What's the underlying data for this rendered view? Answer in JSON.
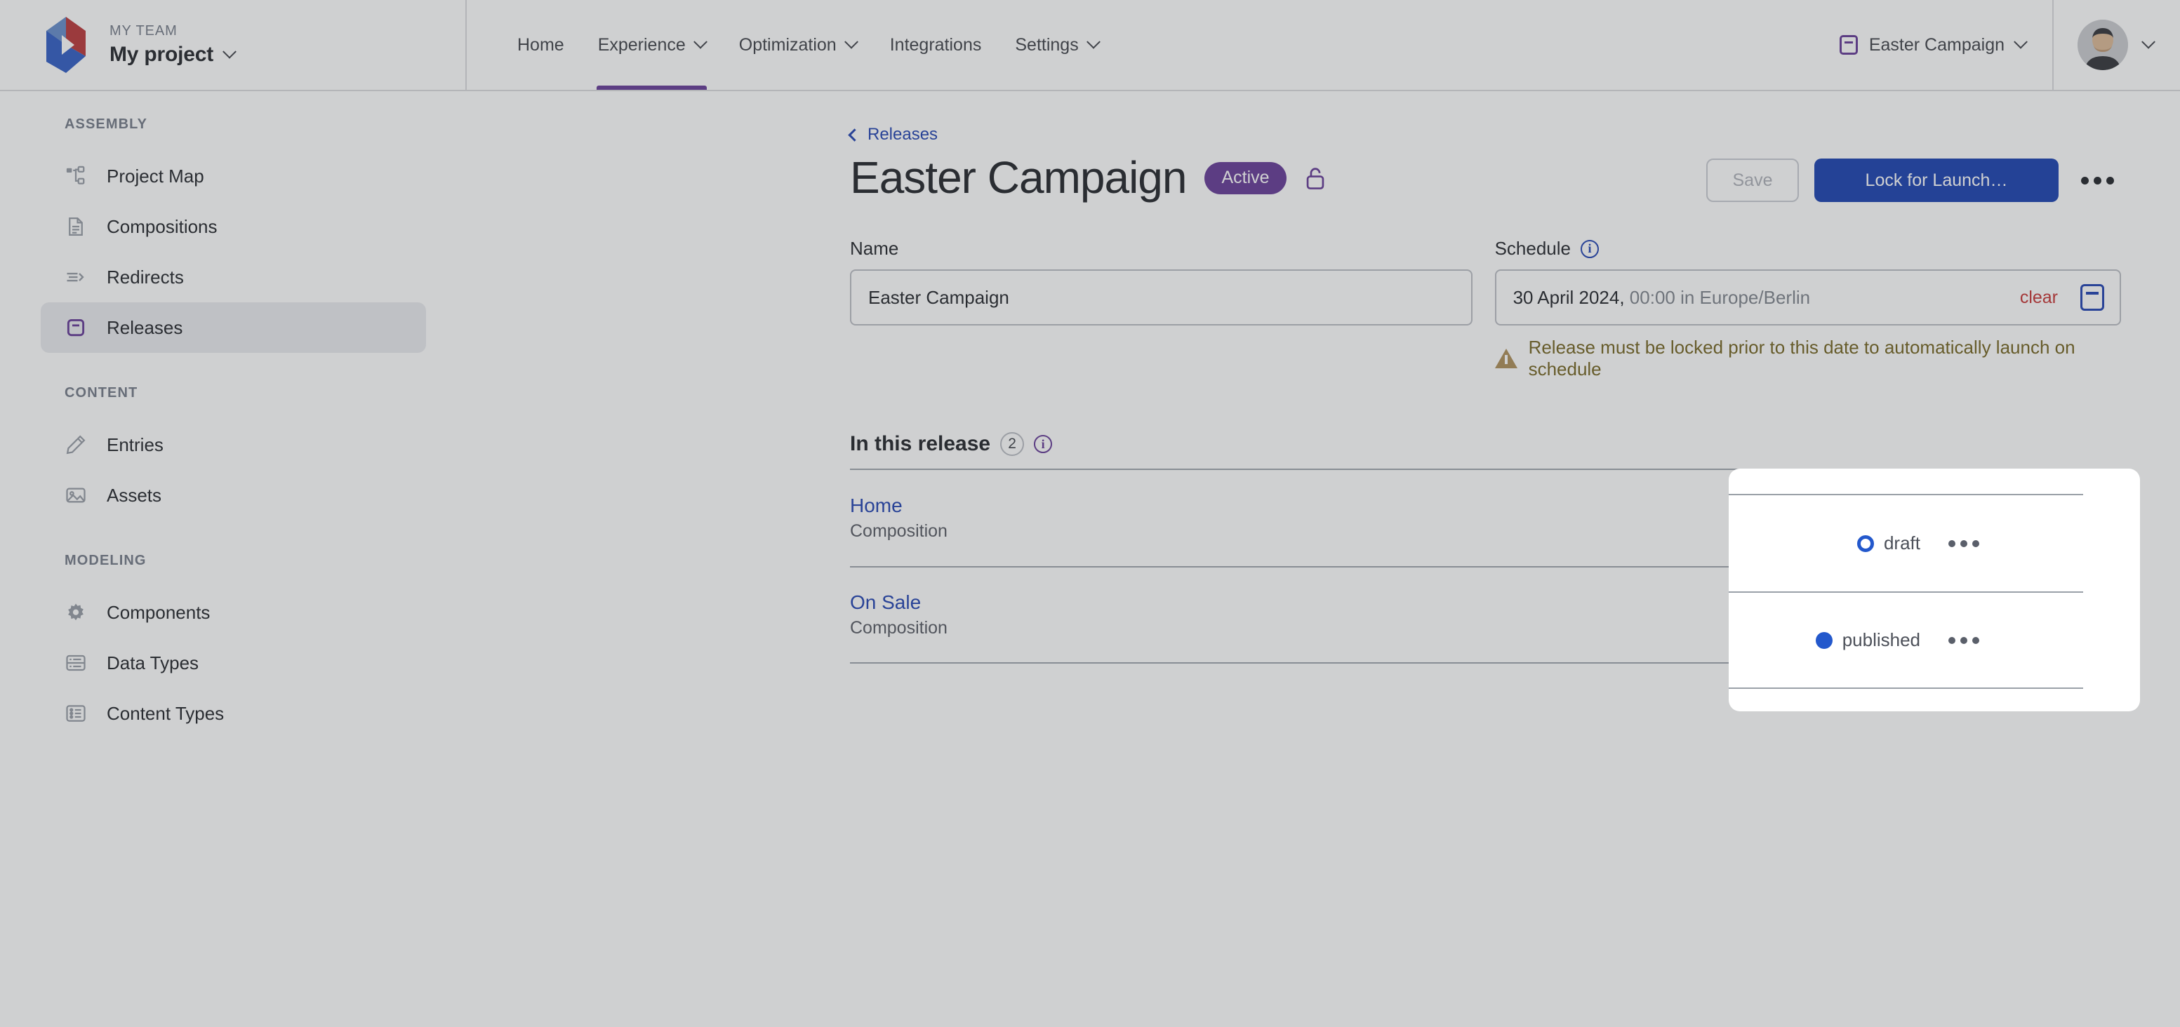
{
  "brand": {
    "team": "MY TEAM",
    "project": "My project",
    "logo_icon": "logo-mark-icon",
    "project_chevron_icon": "chevron-down-icon"
  },
  "topnav": {
    "items": [
      {
        "label": "Home",
        "has_chevron": false,
        "active": false
      },
      {
        "label": "Experience",
        "has_chevron": true,
        "active": true
      },
      {
        "label": "Optimization",
        "has_chevron": true,
        "active": false
      },
      {
        "label": "Integrations",
        "has_chevron": false,
        "active": false
      },
      {
        "label": "Settings",
        "has_chevron": true,
        "active": false
      }
    ],
    "active_underline_color": "#5b2d90",
    "release_selector": {
      "label": "Easter Campaign",
      "icon": "release-box-icon",
      "chevron_icon": "chevron-down-icon"
    },
    "avatar": {
      "name": "avatar",
      "chevron_icon": "chevron-down-icon"
    }
  },
  "sidebar": {
    "sections": [
      {
        "title": "ASSEMBLY",
        "items": [
          {
            "label": "Project Map",
            "icon": "project-map-icon",
            "active": false
          },
          {
            "label": "Compositions",
            "icon": "document-icon",
            "active": false
          },
          {
            "label": "Redirects",
            "icon": "redirect-arrow-icon",
            "active": false
          },
          {
            "label": "Releases",
            "icon": "release-box-icon",
            "active": true
          }
        ]
      },
      {
        "title": "CONTENT",
        "items": [
          {
            "label": "Entries",
            "icon": "pencil-icon",
            "active": false
          },
          {
            "label": "Assets",
            "icon": "image-icon",
            "active": false
          }
        ]
      },
      {
        "title": "MODELING",
        "items": [
          {
            "label": "Components",
            "icon": "gear-icon",
            "active": false
          },
          {
            "label": "Data Types",
            "icon": "data-types-icon",
            "active": false
          },
          {
            "label": "Content Types",
            "icon": "content-types-icon",
            "active": false
          }
        ]
      }
    ]
  },
  "page": {
    "breadcrumb": {
      "label": "Releases",
      "arrow_icon": "chevron-left-icon"
    },
    "title": "Easter Campaign",
    "status_pill": "Active",
    "lock_icon": "unlocked-padlock-icon",
    "actions": {
      "save_label": "Save",
      "save_disabled": true,
      "primary_label": "Lock for Launch…",
      "overflow_icon": "kebab-menu-icon"
    }
  },
  "form": {
    "name": {
      "label": "Name",
      "value": "Easter Campaign",
      "placeholder": "Name"
    },
    "schedule": {
      "label": "Schedule",
      "info_icon": "info-icon",
      "date": "30 April 2024,",
      "time_tz": " 00:00 in Europe/Berlin",
      "clear_label": "clear",
      "calendar_icon": "calendar-icon",
      "warning": "Release must be locked prior to this date to automatically launch on schedule",
      "warning_icon": "warning-triangle-icon"
    }
  },
  "release_contents": {
    "heading": "In this release",
    "count": "2",
    "info_icon": "info-icon",
    "rows": [
      {
        "name": "Home",
        "type": "Composition",
        "status": "draft",
        "status_dot": "hollow",
        "overflow_icon": "kebab-menu-icon"
      },
      {
        "name": "On Sale",
        "type": "Composition",
        "status": "published",
        "status_dot": "filled",
        "overflow_icon": "kebab-menu-icon"
      }
    ]
  },
  "colors": {
    "accent_purple": "#5b2d90",
    "primary_blue": "#0b34ab",
    "link_blue": "#1236ac",
    "status_blue": "#2358cc",
    "danger_red": "#c22525",
    "warning_text": "#6b5a12",
    "scrim": "rgba(96,98,104,0.30)"
  }
}
